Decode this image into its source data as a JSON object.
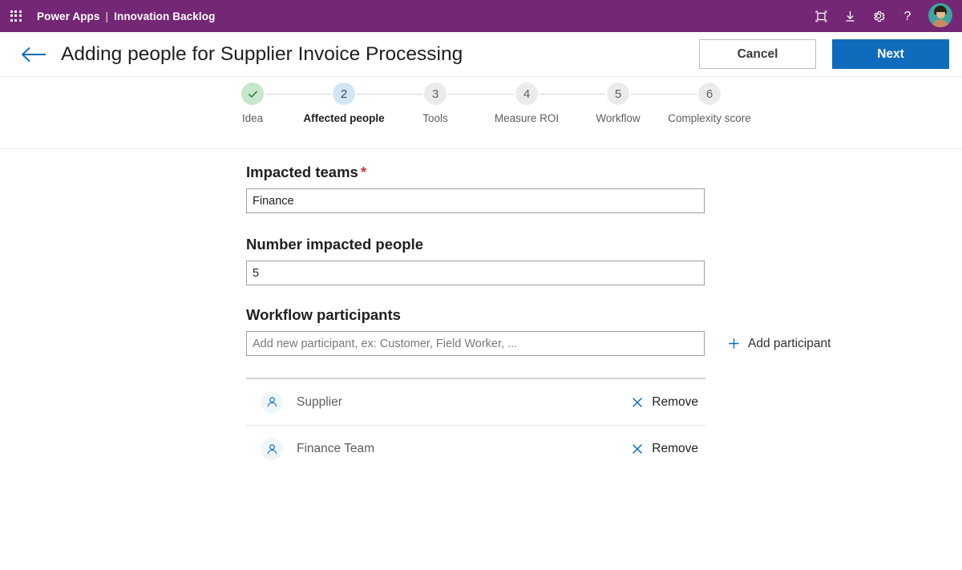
{
  "suite": {
    "waffle_label": "app-launcher",
    "brand": "Power Apps",
    "separator": "|",
    "app_name": "Innovation Backlog",
    "bar_color": "#742774",
    "icons": [
      "fit-to-screen-icon",
      "download-icon",
      "settings-gear-icon",
      "help-question-icon",
      "user-avatar"
    ]
  },
  "header": {
    "back_label": "back-arrow",
    "title": "Adding people for Supplier Invoice Processing",
    "cancel_label": "Cancel",
    "next_label": "Next",
    "accent_color": "#0f6cbd"
  },
  "stepper": {
    "steps": [
      {
        "number": "1",
        "marker": "✓",
        "label": "Idea",
        "state": "done"
      },
      {
        "number": "2",
        "marker": "2",
        "label": "Affected people",
        "state": "active"
      },
      {
        "number": "3",
        "marker": "3",
        "label": "Tools",
        "state": "todo"
      },
      {
        "number": "4",
        "marker": "4",
        "label": "Measure ROI",
        "state": "todo"
      },
      {
        "number": "5",
        "marker": "5",
        "label": "Workflow",
        "state": "todo"
      },
      {
        "number": "6",
        "marker": "6",
        "label": "Complexity score",
        "state": "todo"
      }
    ],
    "done_color": "#c6e7c9",
    "active_color": "#d3e6f5",
    "todo_color": "#ebebeb"
  },
  "form": {
    "impacted_teams": {
      "label": "Impacted teams",
      "required_marker": "*",
      "value": "Finance",
      "placeholder": ""
    },
    "number_impacted_people": {
      "label": "Number impacted people",
      "value": "5",
      "placeholder": ""
    },
    "workflow_participants": {
      "label": "Workflow participants",
      "value": "",
      "placeholder": "Add new participant, ex: Customer, Field Worker, ...",
      "add_button_label": "Add participant",
      "add_button_icon": "plus-icon",
      "participants": [
        {
          "name": "Supplier",
          "remove_label": "Remove",
          "icon": "person-icon"
        },
        {
          "name": "Finance Team",
          "remove_label": "Remove",
          "icon": "person-icon"
        }
      ]
    }
  }
}
